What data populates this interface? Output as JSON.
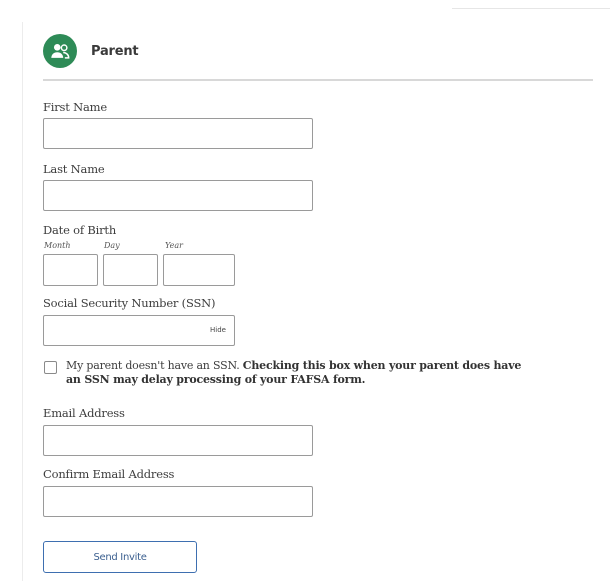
{
  "section": {
    "title": "Parent",
    "icon": "user-group-icon",
    "accent_color": "#2e8b57"
  },
  "fields": {
    "first_name": {
      "label": "First Name",
      "value": ""
    },
    "last_name": {
      "label": "Last Name",
      "value": ""
    },
    "dob": {
      "label": "Date of Birth",
      "month_label": "Month",
      "day_label": "Day",
      "year_label": "Year"
    },
    "ssn": {
      "label": "Social Security Number (SSN)",
      "toggle_label": "Hide"
    },
    "no_ssn": {
      "text": "My parent doesn't have an SSN.",
      "warning": "Checking this box when your parent does have an SSN may delay processing of your FAFSA form.",
      "checked": false
    },
    "email": {
      "label": "Email Address",
      "value": ""
    },
    "confirm_email": {
      "label": "Confirm Email Address",
      "value": ""
    }
  },
  "actions": {
    "send_label": "Send Invite",
    "button_color": "#3e6fb0"
  }
}
